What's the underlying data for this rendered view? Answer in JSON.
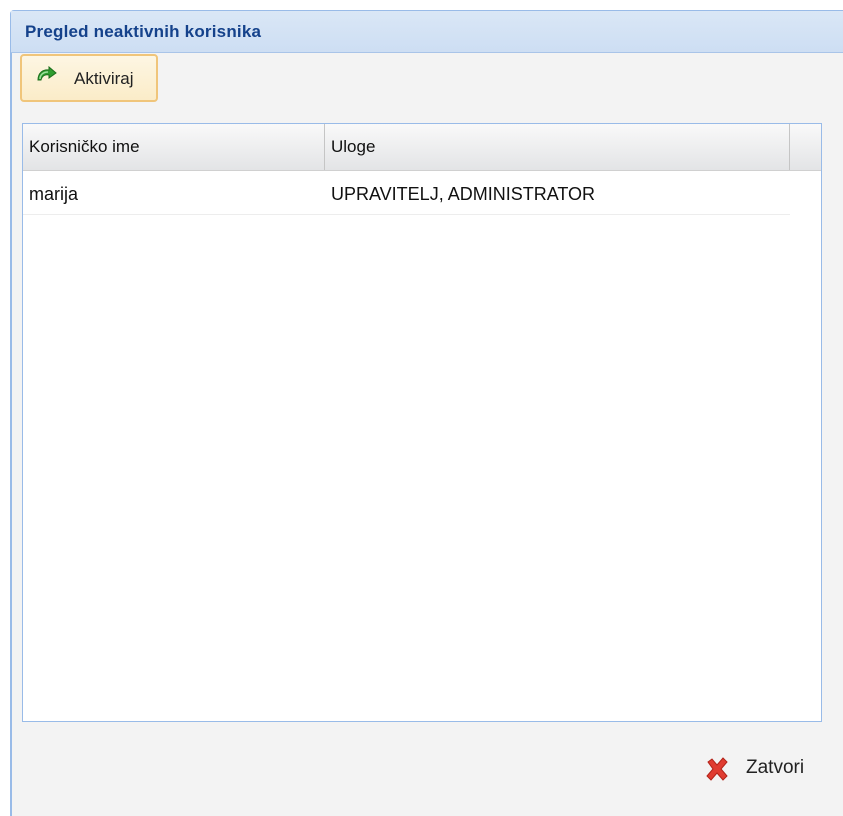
{
  "window": {
    "title": "Pregled neaktivnih korisnika"
  },
  "toolbar": {
    "activate_label": "Aktiviraj",
    "activate_icon": "refresh-arrow-icon"
  },
  "grid": {
    "columns": [
      "Korisničko ime",
      "Uloge"
    ],
    "rows": [
      {
        "username": "marija",
        "roles": "UPRAVITELJ, ADMINISTRATOR"
      }
    ]
  },
  "footer": {
    "close_label": "Zatvori",
    "close_icon": "close-x-icon"
  },
  "colors": {
    "title_text": "#15428b",
    "window_border": "#99bbe8",
    "button_highlight": "#f0c57a",
    "close_icon": "#e03c31",
    "activate_icon": "#2f9d2f"
  }
}
